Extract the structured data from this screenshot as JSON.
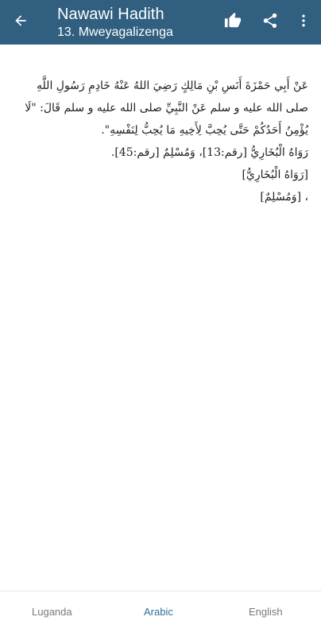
{
  "appbar": {
    "title": "Nawawi Hadith",
    "subtitle": "13. Mweyagalizenga",
    "colors": {
      "background": "#305f80",
      "text": "#ffffff"
    },
    "icons": {
      "back": "arrow-left-icon",
      "like": "thumbs-up-icon",
      "share": "share-icon",
      "more": "more-vert-icon"
    }
  },
  "hadith": {
    "text": "عَنْ أَبِي حَمْزَةَ أَنَسِ بْنِ مَالِكٍ رَضِيَ اللهُ عَنْهُ خَادِمِ رَسُولِ اللَّهِ صلى الله عليه و سلم عَنْ النَّبِيِّ صلى الله عليه و سلم قَالَ: \"لَا يُؤْمِنُ أَحَدُكُمْ حَتَّى يُحِبَّ لِأَخِيهِ مَا يُحِبُّ لِنَفْسِهِ\".",
    "narration": "رَوَاهُ الْبُخَارِيُّ [رقم:13]، وَمُسْلِمٌ [رقم:45].",
    "ref1": "[رَوَاهُ الْبُخَارِيُّ]",
    "ref2": "، [وَمُسْلِمٌ]"
  },
  "tabs": [
    {
      "label": "Luganda",
      "active": false
    },
    {
      "label": "Arabic",
      "active": true
    },
    {
      "label": "English",
      "active": false
    }
  ],
  "colors": {
    "active_tab": "#2e6f93",
    "inactive_tab": "#7a7a7a"
  }
}
